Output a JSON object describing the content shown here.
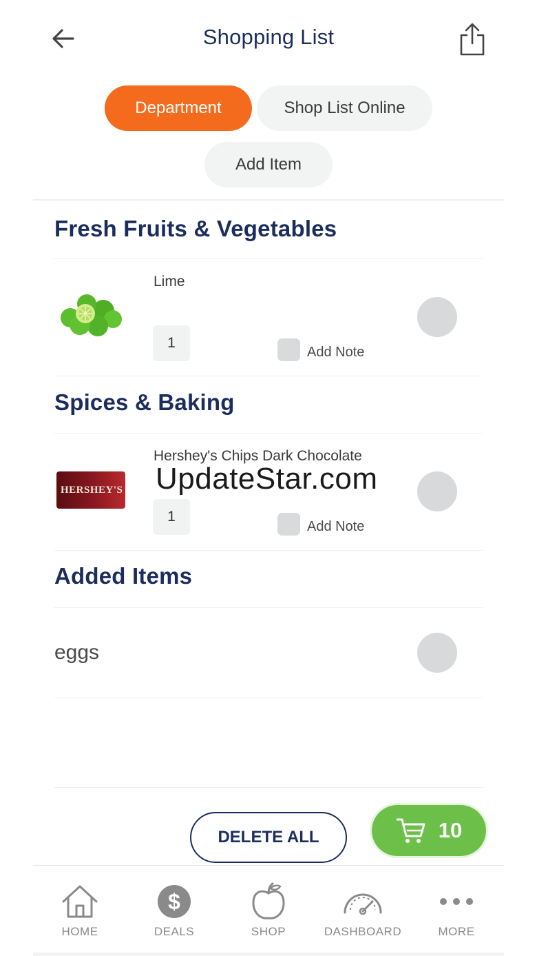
{
  "header": {
    "title": "Shopping List",
    "back_icon": "arrow-left-icon",
    "share_icon": "share-icon"
  },
  "filters": {
    "department_label": "Department",
    "shop_online_label": "Shop List Online",
    "add_item_label": "Add Item",
    "active": "Department",
    "active_color": "#f46b1e"
  },
  "sections": [
    {
      "title": "Fresh Fruits & Vegetables",
      "items": [
        {
          "name": "Lime",
          "quantity": "1",
          "note_label": "Add Note",
          "checked": false
        }
      ]
    },
    {
      "title": "Spices & Baking",
      "items": [
        {
          "name": "Hershey's Chips Dark Chocolate",
          "quantity": "1",
          "note_label": "Add Note",
          "checked": false,
          "package_text": "HERSHEY'S"
        }
      ]
    },
    {
      "title": "Added Items",
      "items": [
        {
          "name": "eggs",
          "checked": false
        }
      ]
    }
  ],
  "watermark": "UpdateStar.com",
  "actions": {
    "delete_all_label": "DELETE ALL",
    "cart_count": "10",
    "cart_color": "#6cc04a"
  },
  "tabbar": {
    "items": [
      {
        "label": "HOME",
        "icon": "home-icon"
      },
      {
        "label": "DEALS",
        "icon": "dollar-icon"
      },
      {
        "label": "SHOP",
        "icon": "apple-icon"
      },
      {
        "label": "DASHBOARD",
        "icon": "gauge-icon"
      },
      {
        "label": "MORE",
        "icon": "more-dots-icon"
      }
    ]
  },
  "colors": {
    "brand_navy": "#1b2d5e",
    "brand_orange": "#f46b1e",
    "brand_green": "#6cc04a"
  }
}
